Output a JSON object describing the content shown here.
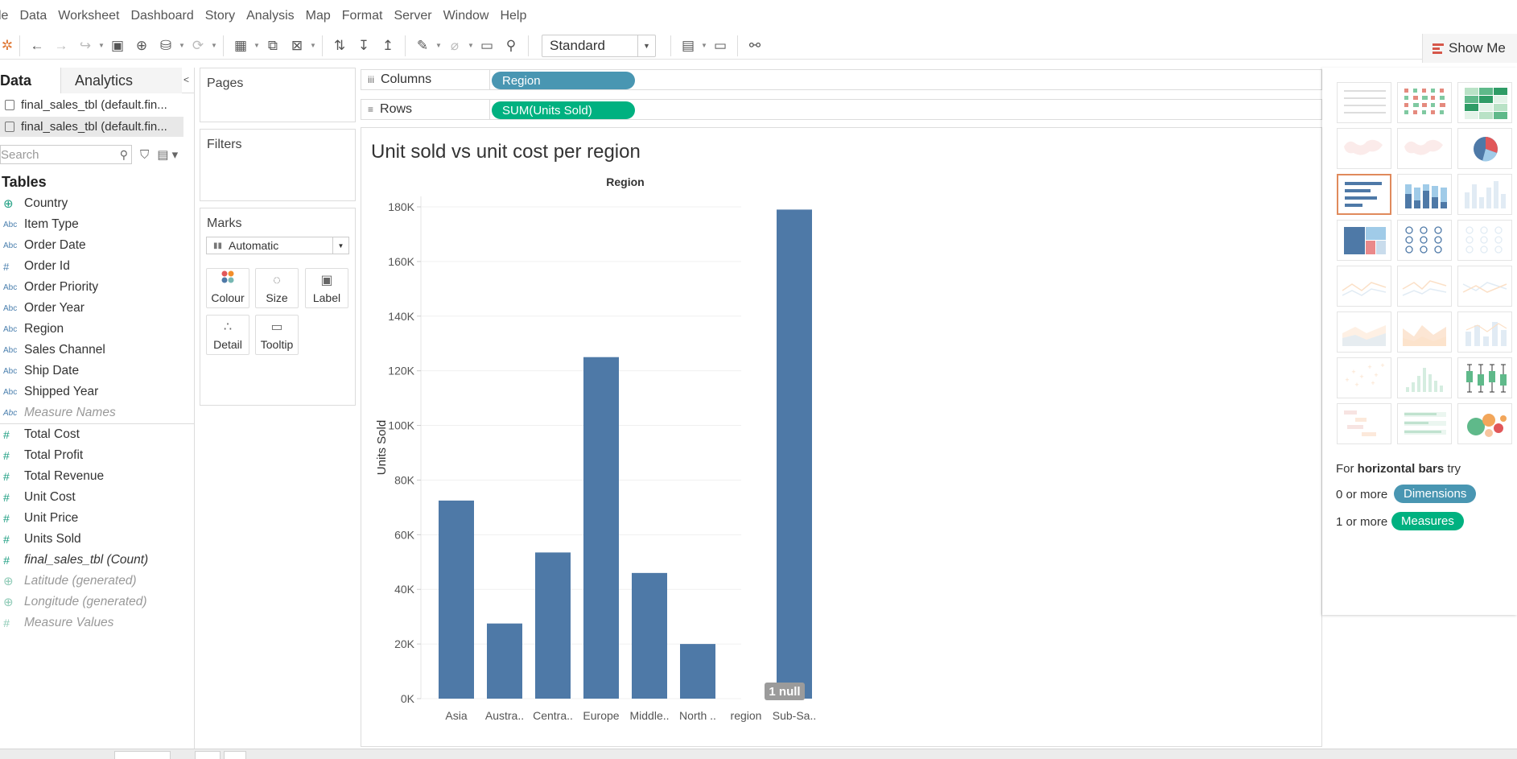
{
  "menu": [
    "le",
    "Data",
    "Worksheet",
    "Dashboard",
    "Story",
    "Analysis",
    "Map",
    "Format",
    "Server",
    "Window",
    "Help"
  ],
  "toolbar": {
    "fit_select": "Standard",
    "show_me_label": "Show Me"
  },
  "data_pane": {
    "tabs": {
      "data": "Data",
      "analytics": "Analytics"
    },
    "sources": [
      "final_sales_tbl (default.fin...",
      "final_sales_tbl (default.fin..."
    ],
    "search_placeholder": "Search",
    "tables_heading": "Tables",
    "dimensions": [
      {
        "type": "globe",
        "label": "Country"
      },
      {
        "type": "Abc",
        "label": "Item Type"
      },
      {
        "type": "Abc",
        "label": "Order Date"
      },
      {
        "type": "#",
        "label": "Order Id"
      },
      {
        "type": "Abc",
        "label": "Order Priority"
      },
      {
        "type": "Abc",
        "label": "Order Year"
      },
      {
        "type": "Abc",
        "label": "Region"
      },
      {
        "type": "Abc",
        "label": "Sales Channel"
      },
      {
        "type": "Abc",
        "label": "Ship Date"
      },
      {
        "type": "Abc",
        "label": "Shipped Year"
      },
      {
        "type": "Abc",
        "label": "Measure Names"
      }
    ],
    "measures": [
      {
        "type": "#",
        "label": "Total Cost"
      },
      {
        "type": "#",
        "label": "Total Profit"
      },
      {
        "type": "#",
        "label": "Total Revenue"
      },
      {
        "type": "#",
        "label": "Unit Cost"
      },
      {
        "type": "#",
        "label": "Unit Price"
      },
      {
        "type": "#",
        "label": "Units Sold"
      },
      {
        "type": "#",
        "label": "final_sales_tbl (Count)"
      },
      {
        "type": "globe",
        "label": "Latitude (generated)"
      },
      {
        "type": "globe",
        "label": "Longitude (generated)"
      },
      {
        "type": "#",
        "label": "Measure Values"
      }
    ]
  },
  "cards": {
    "pages": "Pages",
    "filters": "Filters",
    "marks": "Marks",
    "mark_type": "Automatic",
    "mark_buttons": [
      "Colour",
      "Size",
      "Label",
      "Detail",
      "Tooltip"
    ]
  },
  "shelves": {
    "columns_label": "Columns",
    "rows_label": "Rows",
    "columns_pill": "Region",
    "rows_pill": "SUM(Units Sold)"
  },
  "colors": {
    "dimension_pill": "#4996b2",
    "measure_pill": "#00b180",
    "bar": "#4e79a7",
    "null_badge": "#9b9b9b",
    "selected_thumb": "#e08a5c"
  },
  "sheet": {
    "title": "Unit sold vs unit cost per region"
  },
  "chart_data": {
    "type": "bar",
    "title": "Unit sold vs unit cost per region",
    "xlabel": "Region",
    "ylabel": "Units Sold",
    "categories": [
      "Asia",
      "Austra..",
      "Centra..",
      "Europe",
      "Middle..",
      "North ..",
      "region",
      "Sub-Sa.."
    ],
    "values": [
      72500,
      27500,
      53500,
      125000,
      46000,
      20000,
      0,
      179000
    ],
    "y_ticks": [
      "0K",
      "20K",
      "40K",
      "60K",
      "80K",
      "100K",
      "120K",
      "140K",
      "160K",
      "180K"
    ],
    "ylim": [
      0,
      185000
    ],
    "grid": true,
    "annotation": "1 null"
  },
  "show_me": {
    "hint_prefix": "For ",
    "hint_bold": "horizontal bars",
    "hint_suffix": " try",
    "dim_prefix": "0 or more",
    "dim_pill": "Dimensions",
    "meas_prefix": "1 or more",
    "meas_pill": "Measures"
  }
}
